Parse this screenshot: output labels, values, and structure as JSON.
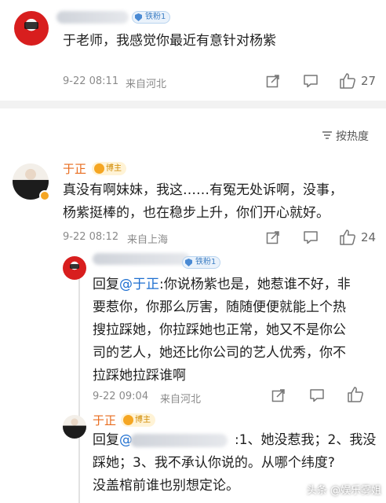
{
  "comment_top": {
    "badge": "铁粉1",
    "text": "于老师，我感觉你最近有意针对杨紫",
    "time": "9-22 08:11",
    "location": "来自河北",
    "likes": "27"
  },
  "sort_label": "按热度",
  "comment_main": {
    "author": "于正",
    "badge": "博主",
    "line1": "真没有啊妹妹，我这……有冤无处诉啊，没事，",
    "line2": "杨紫挺棒的，也在稳步上升，你们开心就好。",
    "time": "9-22 08:12",
    "location": "来自上海",
    "likes": "24"
  },
  "reply_1": {
    "badge": "铁粉1",
    "prefix": "回复",
    "mention": "@于正",
    "lines": [
      ":你说杨紫也是，她惹谁不好，非",
      "要惹你，你那么厉害，随随便便就能上个热",
      "搜拉踩她，你拉踩她也正常，她又不是你公",
      "司的艺人，她还比你公司的艺人优秀，你不",
      "拉踩她拉踩谁啊"
    ],
    "time": "9-22 09:04",
    "location": "来自河北"
  },
  "reply_2": {
    "author": "于正",
    "badge": "博主",
    "prefix": "回复",
    "mention": "@",
    "line1_tail": ":1、她没惹我；2、我没",
    "line2": "踩她；3、我不承认你说的。从哪个纬度?",
    "line3": "没盖棺前谁也别想定论。"
  },
  "watermark": "头条 @娱乐雾姐",
  "colors": {
    "author": "#e86b1d",
    "mention": "#1e6fd0",
    "meta": "#8a8a8a"
  }
}
